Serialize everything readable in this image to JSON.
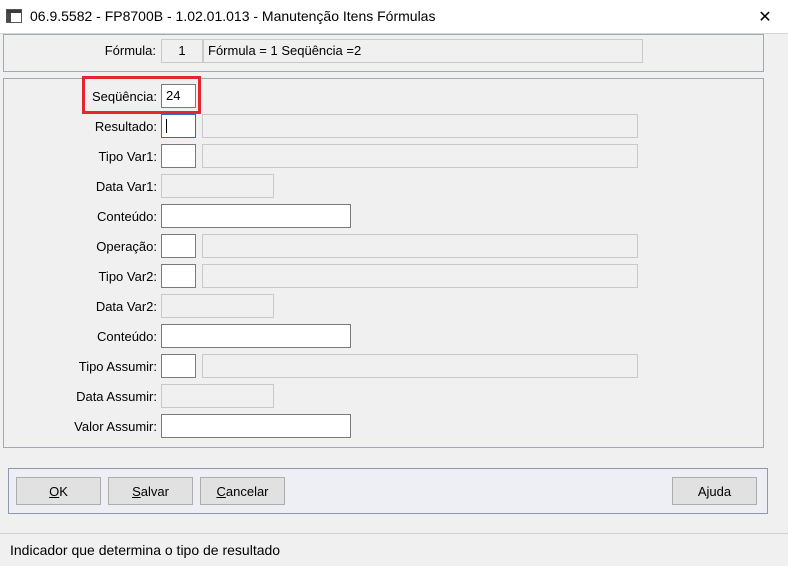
{
  "window": {
    "title": "06.9.5582 - FP8700B - 1.02.01.013 - Manutenção Itens Fórmulas",
    "close_symbol": "✕"
  },
  "header": {
    "formula_label": "Fórmula:",
    "formula_code": "1",
    "formula_description": "Fórmula = 1 Seqüência =2"
  },
  "form": {
    "sequencia_label": "Seqüência:",
    "sequencia_value": "24",
    "resultado_label": "Resultado:",
    "tipo_var1_label": "Tipo Var1:",
    "data_var1_label": "Data Var1:",
    "conteudo1_label": "Conteúdo:",
    "operacao_label": "Operação:",
    "tipo_var2_label": "Tipo Var2:",
    "data_var2_label": "Data Var2:",
    "conteudo2_label": "Conteúdo:",
    "tipo_assumir_label": "Tipo Assumir:",
    "data_assumir_label": "Data Assumir:",
    "valor_assumir_label": "Valor Assumir:"
  },
  "buttons": {
    "ok_mnemonic": "O",
    "ok_rest": "K",
    "salvar_mnemonic": "S",
    "salvar_rest": "alvar",
    "cancelar_mnemonic": "C",
    "cancelar_rest": "ancelar",
    "ajuda_pre": "A",
    "ajuda_mnemonic": "j",
    "ajuda_rest": "uda"
  },
  "status": {
    "text": "Indicador que determina o tipo de resultado"
  },
  "colors": {
    "highlight": "#e3262f",
    "focus_border": "#2d6bc7"
  }
}
